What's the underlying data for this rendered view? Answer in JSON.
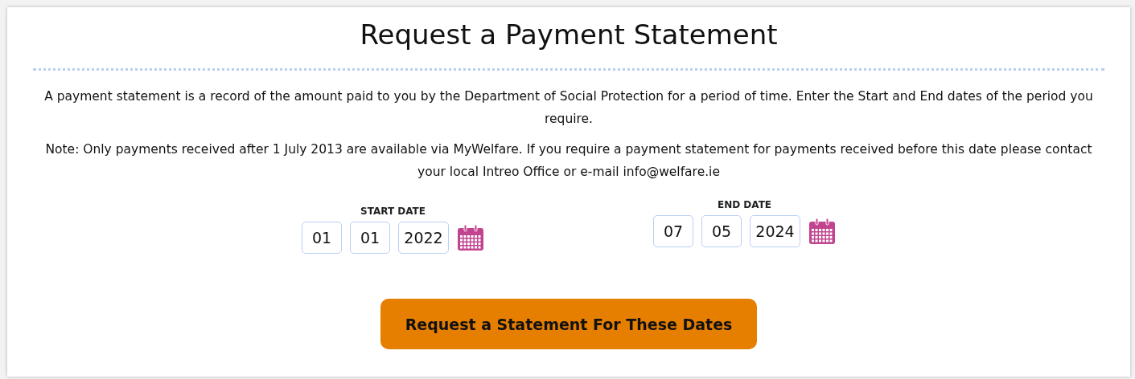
{
  "title": "Request a Payment Statement",
  "paragraphs": [
    "A payment statement is a record of the amount paid to you by the Department of Social Protection for a period of time. Enter the Start and End dates of the period you require.",
    "Note: Only payments received after 1 July 2013 are available via MyWelfare. If you require a payment statement for payments received before this date please contact your local Intreo Office or e-mail info@welfare.ie"
  ],
  "date_groups": [
    {
      "label": "START DATE",
      "day": "01",
      "month": "01",
      "year": "2022"
    },
    {
      "label": "END DATE",
      "day": "07",
      "month": "05",
      "year": "2024"
    }
  ],
  "submit_button": "Request a Statement For These Dates"
}
